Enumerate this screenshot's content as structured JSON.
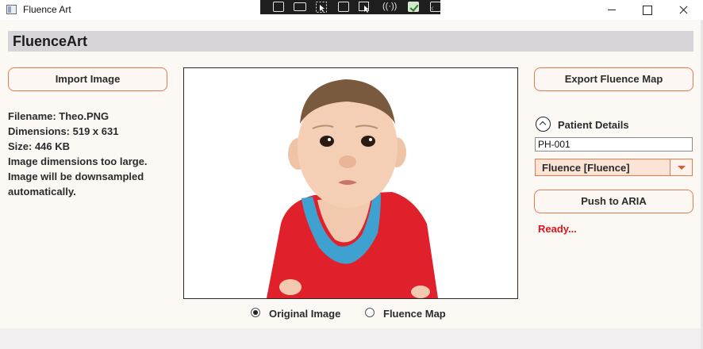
{
  "window": {
    "title": "Fluence Art"
  },
  "header": {
    "title": "FluenceArt"
  },
  "left_panel": {
    "import_button": "Import Image",
    "info_lines": [
      "Filename: Theo.PNG",
      "Dimensions: 519 x 631",
      "Size: 446 KB",
      "Image dimensions too large.",
      "Image will be downsampled",
      "automatically."
    ]
  },
  "viewer": {
    "radio_options": [
      {
        "label": "Original Image",
        "selected": true
      },
      {
        "label": "Fluence Map",
        "selected": false
      }
    ]
  },
  "right_panel": {
    "export_button": "Export Fluence Map",
    "patient_details_label": "Patient Details",
    "patient_id_value": "PH-001",
    "plan_select_value": "Fluence [Fluence]",
    "push_button": "Push to ARIA",
    "status": "Ready..."
  },
  "colors": {
    "accent_border": "#e47b4f",
    "status_text": "#e0141e",
    "header_band": "#d7d4da"
  }
}
